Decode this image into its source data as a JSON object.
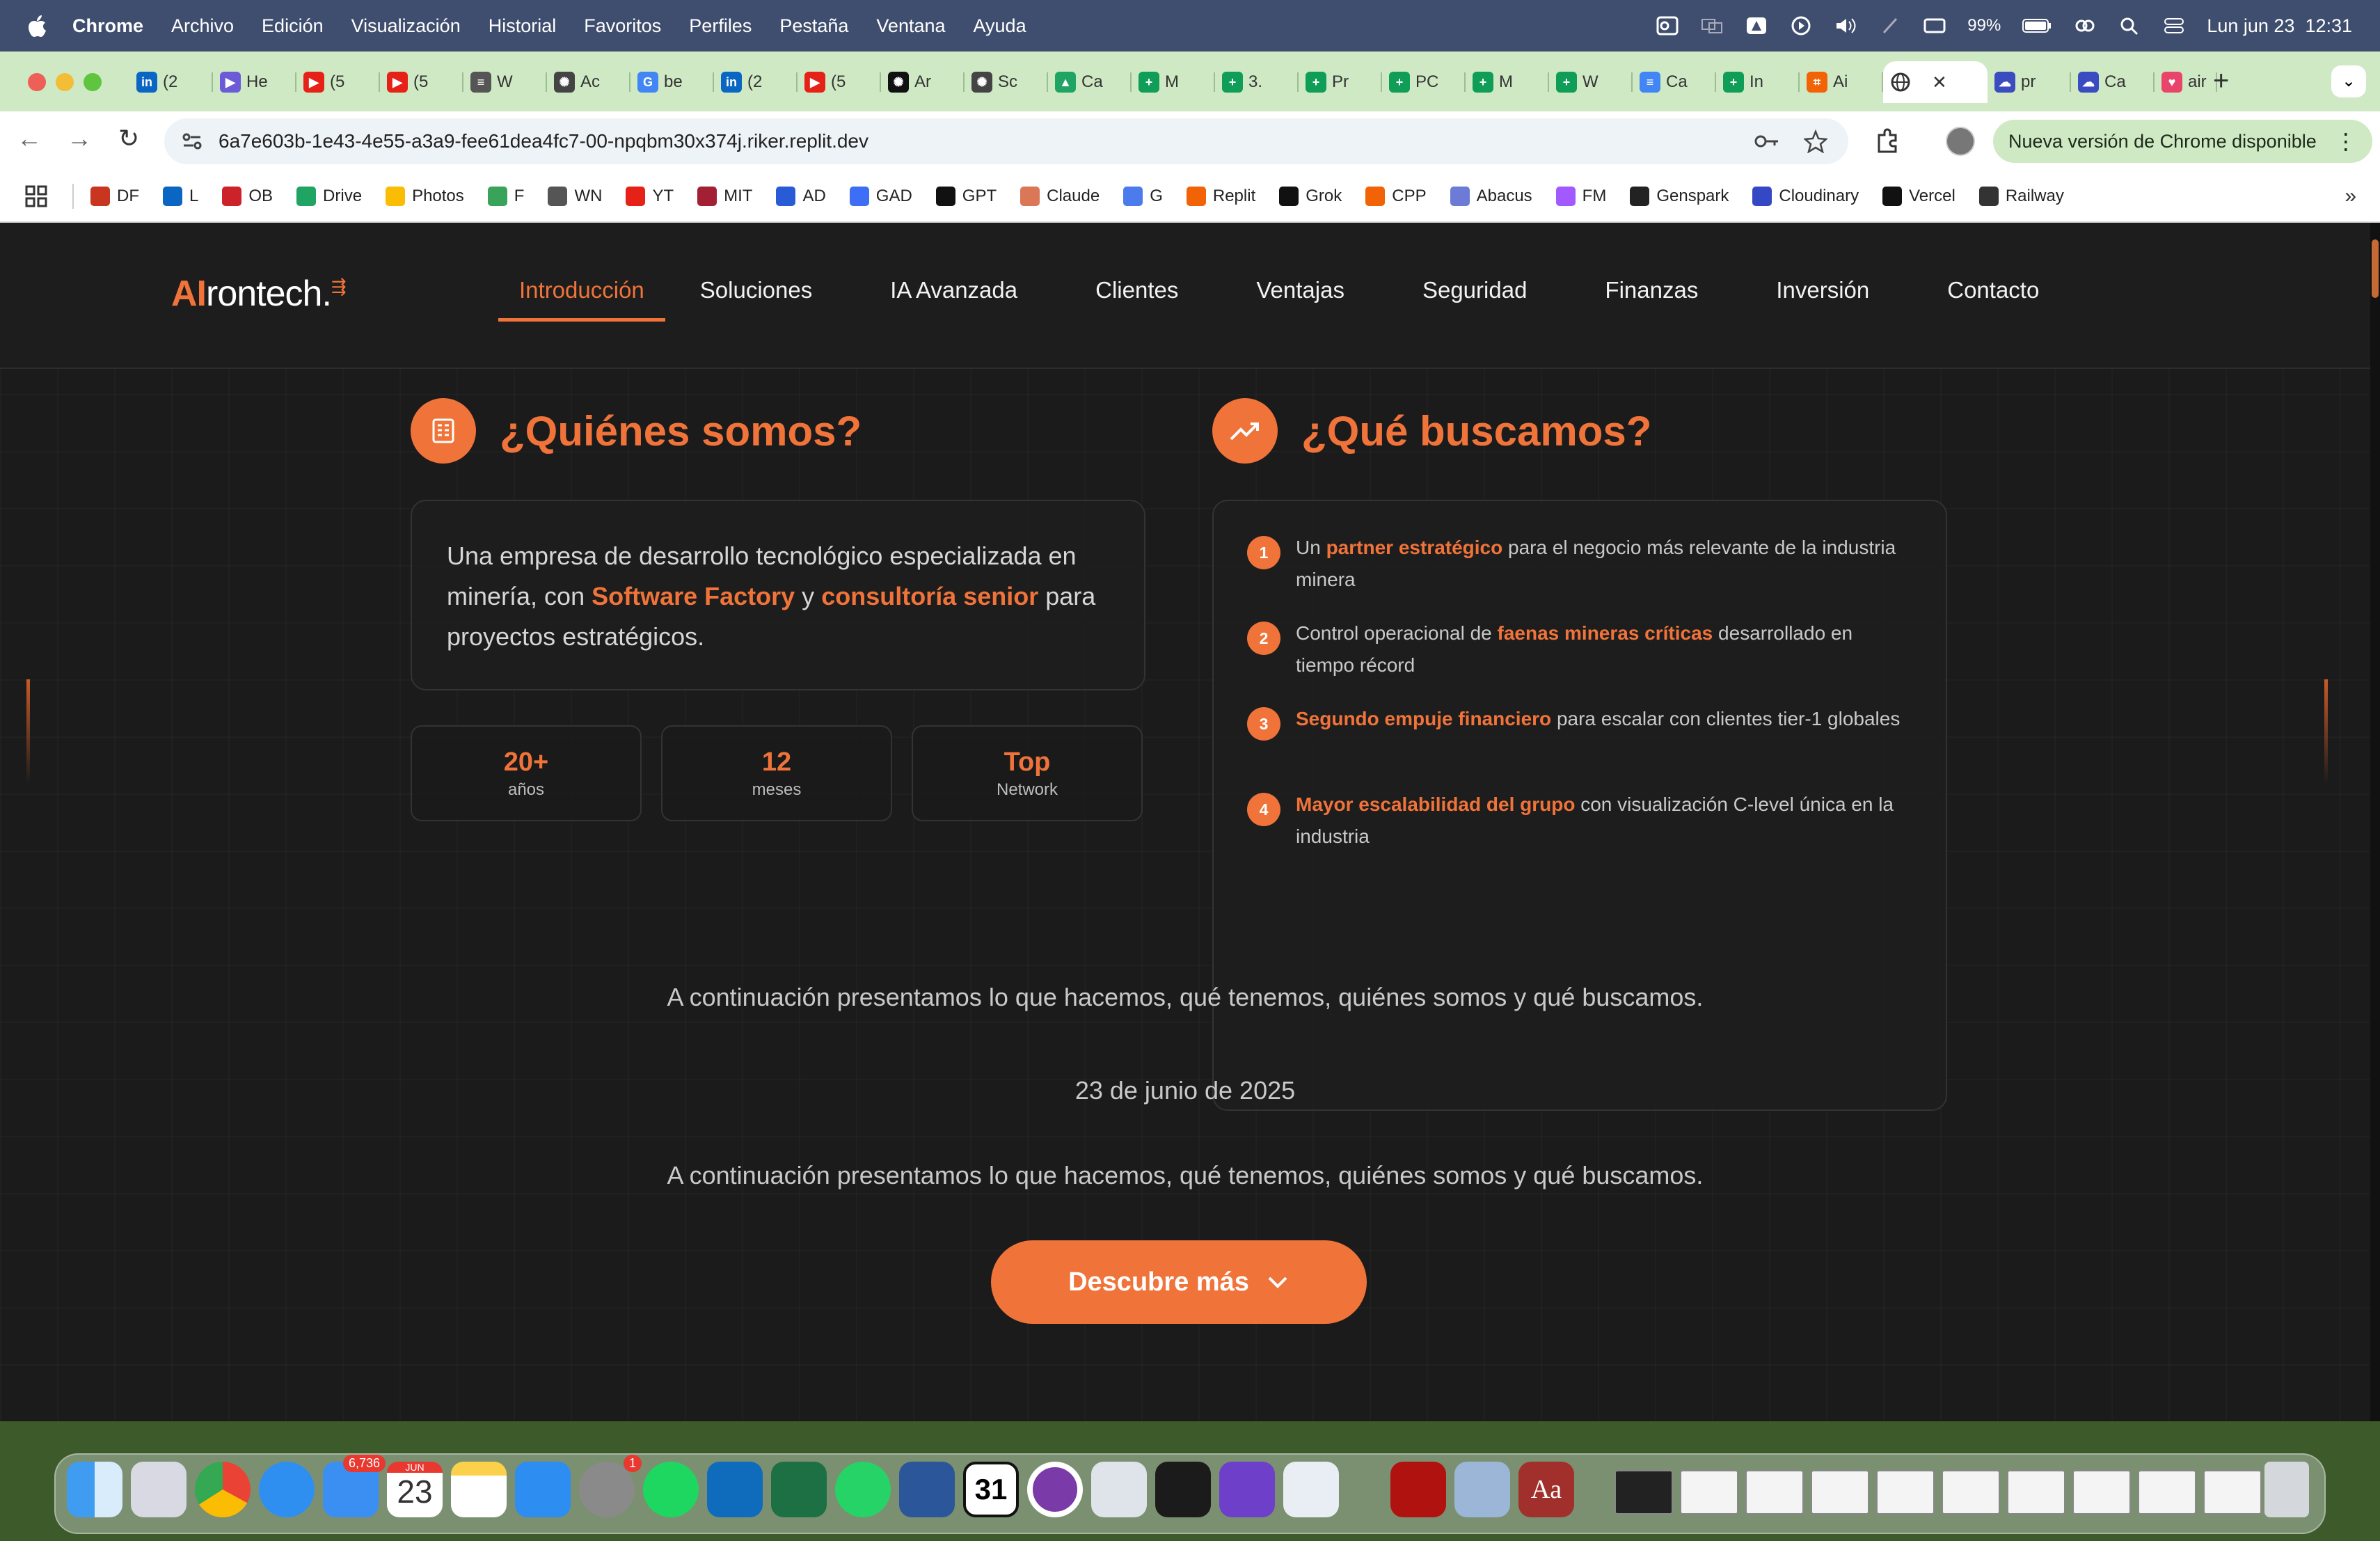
{
  "menubar": {
    "app": "Chrome",
    "items": [
      "Archivo",
      "Edición",
      "Visualización",
      "Historial",
      "Favoritos",
      "Perfiles",
      "Pestaña",
      "Ventana",
      "Ayuda"
    ],
    "battery": "99%",
    "datetime": "Lun jun 23  12:31"
  },
  "tabs": [
    {
      "label": "(2",
      "icon": "linkedin-icon",
      "color": "#0a66c2"
    },
    {
      "label": "He",
      "icon": "play-circle-icon",
      "color": "#6b5bd6"
    },
    {
      "label": "(5",
      "icon": "youtube-icon",
      "color": "#e62117"
    },
    {
      "label": "(5",
      "icon": "youtube-icon",
      "color": "#e62117"
    },
    {
      "label": "W",
      "icon": "document-icon",
      "color": "#555555"
    },
    {
      "label": "Ac",
      "icon": "gear-icon",
      "color": "#444444"
    },
    {
      "label": "be",
      "icon": "google-icon",
      "color": "#4285f4"
    },
    {
      "label": "(2",
      "icon": "linkedin-icon",
      "color": "#0a66c2"
    },
    {
      "label": "(5",
      "icon": "youtube-icon",
      "color": "#e62117"
    },
    {
      "label": "Ar",
      "icon": "openai-icon",
      "color": "#111111"
    },
    {
      "label": "Sc",
      "icon": "gear-icon",
      "color": "#444444"
    },
    {
      "label": "Ca",
      "icon": "drive-icon",
      "color": "#1fa463"
    },
    {
      "label": "M",
      "icon": "sheets-icon",
      "color": "#0f9d58"
    },
    {
      "label": "3.",
      "icon": "sheets-icon",
      "color": "#0f9d58"
    },
    {
      "label": "Pr",
      "icon": "sheets-icon",
      "color": "#0f9d58"
    },
    {
      "label": "PC",
      "icon": "sheets-icon",
      "color": "#0f9d58"
    },
    {
      "label": "M",
      "icon": "sheets-icon",
      "color": "#0f9d58"
    },
    {
      "label": "W",
      "icon": "sheets-icon",
      "color": "#0f9d58"
    },
    {
      "label": "Ca",
      "icon": "docs-icon",
      "color": "#4285f4"
    },
    {
      "label": "In",
      "icon": "sheets-icon",
      "color": "#0f9d58"
    },
    {
      "label": "Ai",
      "icon": "replit-icon",
      "color": "#f26207"
    }
  ],
  "active_tab": {
    "icon": "globe-icon"
  },
  "tabs_after": [
    {
      "label": "pr",
      "icon": "cloud-icon",
      "color": "#3b4cc0"
    },
    {
      "label": "Ca",
      "icon": "cloud-icon",
      "color": "#3b4cc0"
    },
    {
      "label": "air",
      "icon": "heart-icon",
      "color": "#e9456b"
    }
  ],
  "toolbar": {
    "url": "6a7e603b-1e43-4e55-a3a9-fee61dea4fc7-00-npqbm30x374j.riker.replit.dev",
    "update_label": "Nueva versión de Chrome disponible"
  },
  "bookmarks": [
    {
      "label": "DF",
      "color": "#c8361f"
    },
    {
      "label": "L",
      "color": "#0a66c2"
    },
    {
      "label": "OB",
      "color": "#cc2229"
    },
    {
      "label": "Drive",
      "color": "#1fa463"
    },
    {
      "label": "Photos",
      "color": "#fbbc04"
    },
    {
      "label": "F",
      "color": "#3aa35a"
    },
    {
      "label": "WN",
      "color": "#555555"
    },
    {
      "label": "YT",
      "color": "#e62117"
    },
    {
      "label": "MIT",
      "color": "#a31f34"
    },
    {
      "label": "AD",
      "color": "#2a5bd7"
    },
    {
      "label": "GAD",
      "color": "#3d6ef5"
    },
    {
      "label": "GPT",
      "color": "#111111"
    },
    {
      "label": "Claude",
      "color": "#d97757"
    },
    {
      "label": "G",
      "color": "#4b7bec"
    },
    {
      "label": "Replit",
      "color": "#f26207"
    },
    {
      "label": "Grok",
      "color": "#111111"
    },
    {
      "label": "CPP",
      "color": "#f26207"
    },
    {
      "label": "Abacus",
      "color": "#6b7bd6"
    },
    {
      "label": "FM",
      "color": "#a259ff"
    },
    {
      "label": "Genspark",
      "color": "#222222"
    },
    {
      "label": "Cloudinary",
      "color": "#3448c5"
    },
    {
      "label": "Vercel",
      "color": "#111111"
    },
    {
      "label": "Railway",
      "color": "#333333"
    }
  ],
  "site": {
    "logo_ai": "AI",
    "logo_rest": "rontech.",
    "nav": [
      "Introducción",
      "Soluciones",
      "IA Avanzada",
      "Clientes",
      "Ventajas",
      "Seguridad",
      "Finanzas",
      "Inversión",
      "Contacto"
    ],
    "who": {
      "title": "¿Quiénes somos?",
      "text_1": "Una empresa de desarrollo tecnológico especializada en minería, con ",
      "hl_1": "Software Factory",
      "text_2": " y ",
      "hl_2": "consultoría senior",
      "text_3": " para proyectos estratégicos.",
      "stats": [
        {
          "value": "20+",
          "label": "años"
        },
        {
          "value": "12",
          "label": "meses"
        },
        {
          "value": "Top",
          "label": "Network"
        }
      ]
    },
    "what": {
      "title": "¿Qué buscamos?",
      "items": [
        {
          "n": "1",
          "pre": "Un ",
          "hl": "partner estratégico",
          "post": " para el negocio más relevante de la industria minera"
        },
        {
          "n": "2",
          "pre": "Control operacional de ",
          "hl": "faenas mineras críticas",
          "post": " desarrollado en tiempo récord"
        },
        {
          "n": "3",
          "pre": "",
          "hl": "Segundo empuje financiero",
          "post": " para escalar con clientes tier-1 globales"
        },
        {
          "n": "4",
          "pre": "",
          "hl": "Mayor escalabilidad del grupo",
          "post": " con visualización C-level única en la industria"
        }
      ]
    },
    "paragraph_1": "A continuación presentamos lo que hacemos, qué tenemos, quiénes somos y qué buscamos.",
    "date": "23 de junio de 2025",
    "paragraph_2": "A continuación presentamos lo que hacemos, qué tenemos, quiénes somos y qué buscamos.",
    "cta": "Descubre más",
    "accent": "#f0733a"
  },
  "dock": {
    "mail_badge": "6,736",
    "calendar_month": "JUN",
    "calendar_day": "23",
    "settings_badge": "1",
    "date_app_day": "31",
    "dict_label": "Aa",
    "apps": [
      "finder-icon",
      "launchpad-icon",
      "chrome-icon",
      "safari-icon",
      "mail-icon",
      "calendar-icon",
      "notes-icon",
      "keynote-icon",
      "settings-icon",
      "spotify-icon",
      "outlook-icon",
      "excel-icon",
      "whatsapp-icon",
      "word-icon",
      "date-icon",
      "screen-recorder-icon",
      "iphone-mirroring-icon",
      "stack-icon",
      "github-icon",
      "vscode-icon",
      "acrobat-icon",
      "preview-icon",
      "dictionary-icon"
    ]
  }
}
